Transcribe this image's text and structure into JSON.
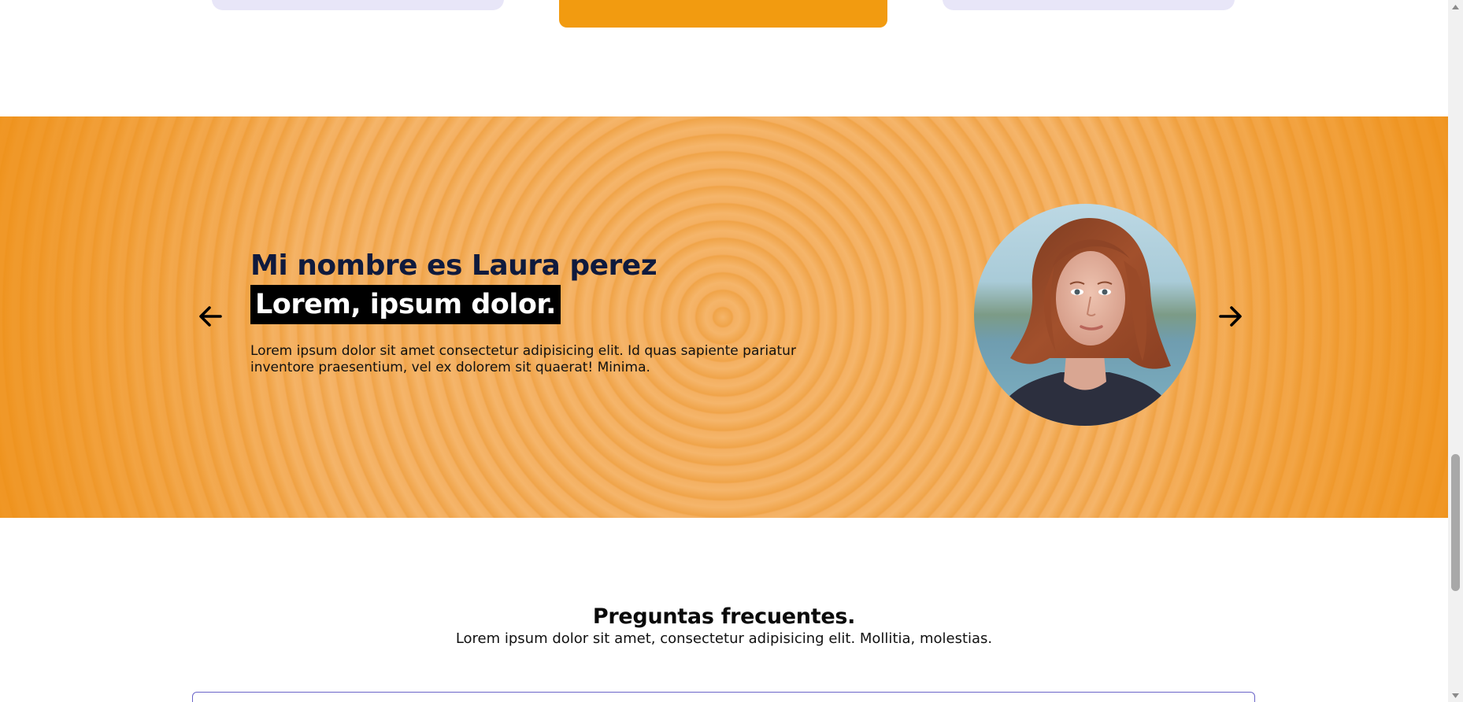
{
  "testimonial": {
    "name": "Mi nombre es Laura perez",
    "highlight": "Lorem, ipsum dolor.",
    "body": "Lorem ipsum dolor sit amet consectetur adipisicing elit. Id quas sapiente pariatur inventore praesentium, vel ex dolorem sit quaerat! Minima.",
    "prev_icon": "arrow-left-icon",
    "next_icon": "arrow-right-icon"
  },
  "faq": {
    "title": "Preguntas frecuentes.",
    "subtitle": "Lorem ipsum dolor sit amet, consectetur adipisicing elit. Mollitia, molestias."
  },
  "colors": {
    "accent_orange": "#f29b10",
    "card_lavender": "#e8e6f8",
    "heading_navy": "#0f1a3d",
    "faq_border": "#6a64c8"
  }
}
